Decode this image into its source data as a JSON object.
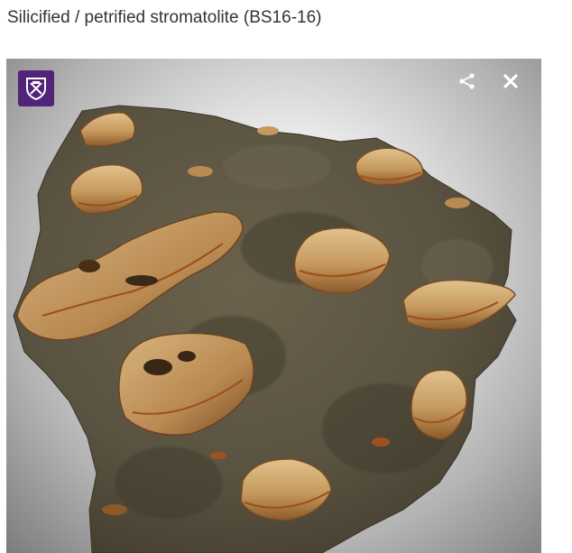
{
  "page": {
    "title": "Silicified / petrified stromatolite (BS16-16)"
  },
  "viewer": {
    "logo_icon": "university-shield-icon",
    "share_icon": "share-icon",
    "close_icon": "close-icon",
    "colors": {
      "logo_background": "#51247a",
      "controls": "#ffffff",
      "rock_base": "#5a5341",
      "stromatolite_tan": "#c69a5e",
      "iron_stain": "#a0521e"
    }
  }
}
